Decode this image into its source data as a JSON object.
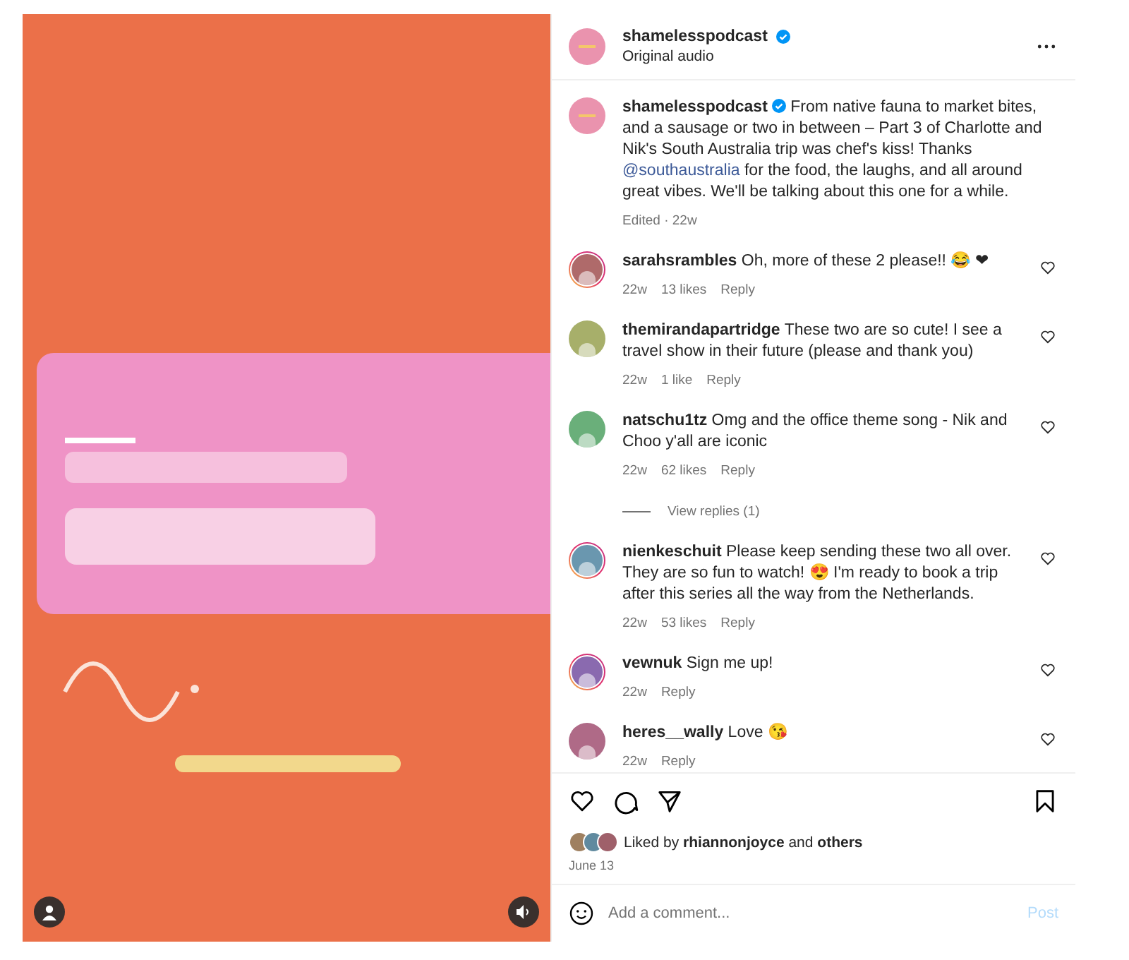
{
  "post": {
    "author": "shamelesspodcast",
    "verified": true,
    "audio": "Original audio"
  },
  "caption": {
    "author": "shamelesspodcast",
    "verified": true,
    "before": "From native fauna to market bites, and a sausage or two in between – Part 3 of Charlotte and Nik's South Australia trip was chef's kiss! Thanks",
    "mention": "@southaustralia",
    "after": "for the food, the laughs, and all around great vibes. We'll be talking about this one for a while.",
    "meta": "Edited · 22w"
  },
  "comments": [
    {
      "user": "sarahsrambles",
      "text": "Oh, more of these 2 please!! 😂 ❤",
      "time": "22w",
      "likes": "13 likes",
      "reply": "Reply",
      "story_ring": true
    },
    {
      "user": "themirandapartridge",
      "text": "These two are so cute! I see a travel show in their future (please and thank you)",
      "time": "22w",
      "likes": "1 like",
      "reply": "Reply",
      "story_ring": false
    },
    {
      "user": "natschu1tz",
      "text": "Omg and the office theme song - Nik and Choo y'all are iconic",
      "time": "22w",
      "likes": "62 likes",
      "reply": "Reply",
      "story_ring": false,
      "view_replies": "View replies (1)"
    },
    {
      "user": "nienkeschuit",
      "text": "Please keep sending these two all over. They are so fun to watch! 😍 I'm ready to book a trip after this series all the way from the Netherlands.",
      "time": "22w",
      "likes": "53 likes",
      "reply": "Reply",
      "story_ring": true
    },
    {
      "user": "vewnuk",
      "text": "Sign me up!",
      "time": "22w",
      "reply": "Reply",
      "story_ring": true
    },
    {
      "user": "heres__wally",
      "text": "Love 😘",
      "time": "22w",
      "reply": "Reply",
      "story_ring": false
    }
  ],
  "likes": {
    "text": "Liked by **rhiannonjoyce** and **others**",
    "date": "June 13"
  },
  "composer": {
    "placeholder": "Add a comment...",
    "post": "Post",
    "disabled": true
  }
}
